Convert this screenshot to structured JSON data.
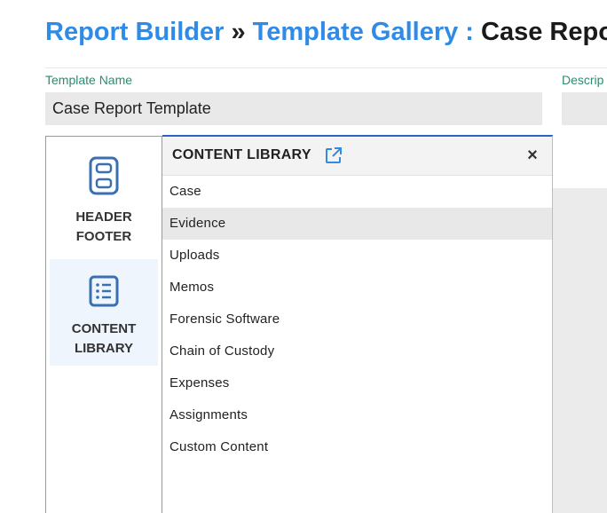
{
  "breadcrumb": {
    "root": "Report Builder",
    "separator": "»",
    "gallery": "Template Gallery",
    "colon": ":",
    "current": "Case Report"
  },
  "form": {
    "template_name_label": "Template Name",
    "template_name_value": "Case Report Template",
    "description_label": "Descrip"
  },
  "sidebar": {
    "items": [
      {
        "line1": "HEADER",
        "line2": "FOOTER",
        "icon": "header-footer-icon"
      },
      {
        "line1": "CONTENT",
        "line2": "LIBRARY",
        "icon": "list-icon",
        "active": true
      }
    ]
  },
  "panel": {
    "title": "CONTENT LIBRARY",
    "close": "×",
    "items": [
      "Case",
      "Evidence",
      "Uploads",
      "Memos",
      "Forensic Software",
      "Chain of Custody",
      "Expenses",
      "Assignments",
      "Custom Content"
    ],
    "selected_index": 1
  },
  "colors": {
    "link_blue": "#2f8be6",
    "label_green": "#2e8b71",
    "panel_border_blue": "#2a63c4",
    "icon_blue": "#3a6fb0"
  }
}
